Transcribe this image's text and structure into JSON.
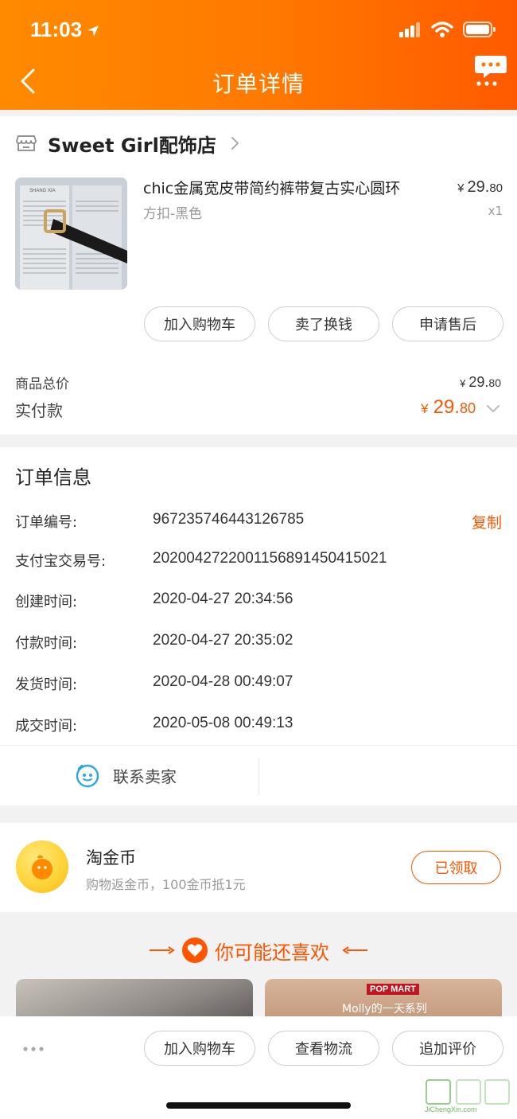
{
  "status_bar": {
    "time": "11:03"
  },
  "nav": {
    "title": "订单详情"
  },
  "shop": {
    "name": "Sweet Girl配饰店"
  },
  "product": {
    "title": "chic金属宽皮带简约裤带复古实心圆环",
    "spec": "方扣-黑色",
    "price_yen": "¥",
    "price_main": "29.",
    "price_cents": "80",
    "quantity": "x1",
    "image_text": "SHANG XIA"
  },
  "actions": {
    "add_cart": "加入购物车",
    "resell": "卖了换钱",
    "after_sale": "申请售后"
  },
  "summary": {
    "total_label": "商品总价",
    "total_yen": "¥",
    "total_main": "29.",
    "total_cents": "80",
    "paid_label": "实付款",
    "paid_yen": "¥",
    "paid_main": "29.",
    "paid_cents": "80"
  },
  "order_info": {
    "title": "订单信息",
    "copy_label": "复制",
    "rows": [
      {
        "label": "订单编号:",
        "value": "967235746443126785"
      },
      {
        "label": "支付宝交易号:",
        "value": "2020042722001156891450415021"
      },
      {
        "label": "创建时间:",
        "value": "2020-04-27 20:34:56"
      },
      {
        "label": "付款时间:",
        "value": "2020-04-27 20:35:02"
      },
      {
        "label": "发货时间:",
        "value": "2020-04-28 00:49:07"
      },
      {
        "label": "成交时间:",
        "value": "2020-05-08 00:49:13"
      }
    ],
    "contact_label": "联系卖家"
  },
  "coin": {
    "title": "淘金币",
    "desc": "购物返金币，100金币抵1元",
    "button": "已领取"
  },
  "recommend": {
    "title": "你可能还喜欢",
    "right_tag": "POP MART",
    "right_caption": "Molly的一天系列"
  },
  "bottom_bar": {
    "add_cart": "加入购物车",
    "logistics": "查看物流",
    "review": "追加评价"
  },
  "watermark": {
    "text": "JiChengXin.com"
  },
  "colors": {
    "accent": "#ff5500",
    "header_start": "#ff8a00",
    "header_end": "#ff5a00"
  }
}
